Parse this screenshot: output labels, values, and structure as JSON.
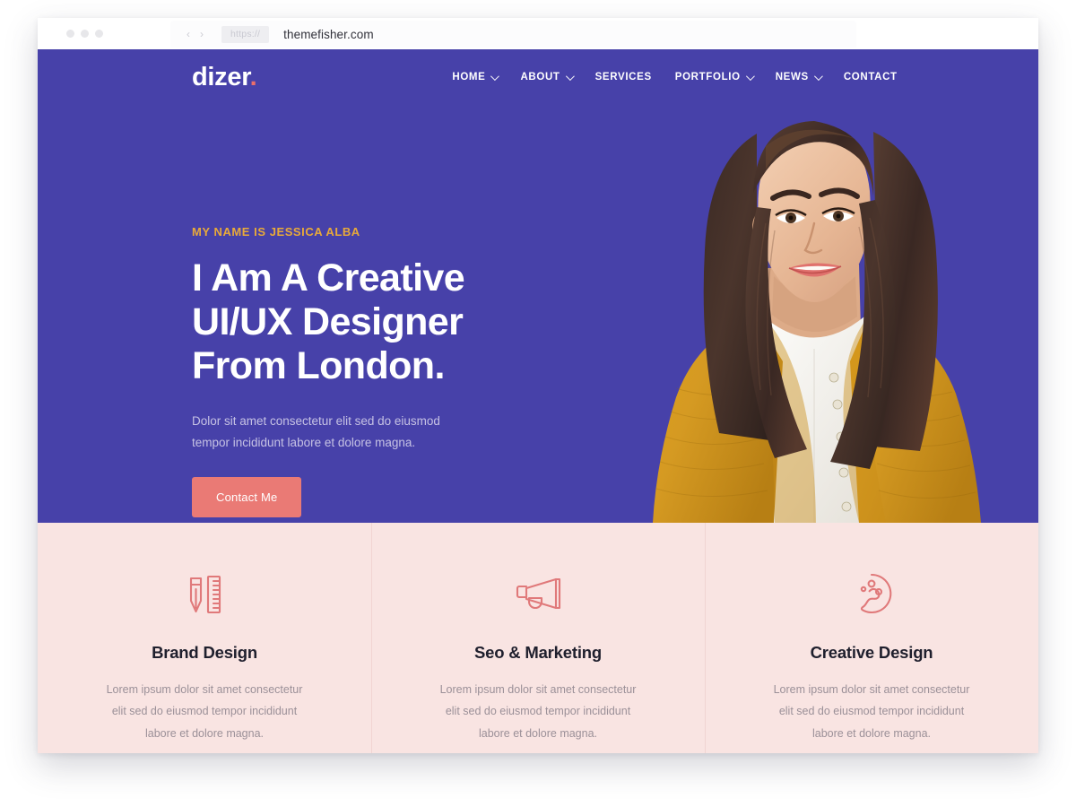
{
  "browser": {
    "traffic_lights": [
      "close",
      "minimize",
      "maximize"
    ],
    "back_arrow": "‹",
    "forward_arrow": "›",
    "scheme_badge": "https://",
    "url": "themefisher.com"
  },
  "colors": {
    "hero_purple": "#4741a9",
    "accent_gold": "#e9aa39",
    "accent_salmon": "#ea7a75",
    "services_pink": "#f9e4e2",
    "heading_dark": "#1f1f2d"
  },
  "header": {
    "logo_text": "dizer",
    "logo_dot": ".",
    "menu": [
      {
        "label": "HOME",
        "has_dropdown": true
      },
      {
        "label": "ABOUT",
        "has_dropdown": true
      },
      {
        "label": "SERVICES",
        "has_dropdown": false
      },
      {
        "label": "PORTFOLIO",
        "has_dropdown": true
      },
      {
        "label": "NEWS",
        "has_dropdown": true
      },
      {
        "label": "CONTACT",
        "has_dropdown": false
      }
    ]
  },
  "hero": {
    "eyebrow": "MY NAME IS JESSICA ALBA",
    "title_line1": "I Am A Creative",
    "title_line2": "UI/UX Designer",
    "title_line3": "From London.",
    "paragraph": "Dolor sit amet consectetur elit sed do eiusmod tempor incididunt labore et dolore magna.",
    "cta_label": "Contact Me",
    "portrait_alt": "smiling woman in mustard cardigan"
  },
  "services": [
    {
      "icon": "pencil-ruler-icon",
      "title": "Brand Design",
      "text": "Lorem ipsum dolor sit amet consectetur elit sed do eiusmod tempor incididunt labore et dolore magna."
    },
    {
      "icon": "megaphone-icon",
      "title": "Seo & Marketing",
      "text": "Lorem ipsum dolor sit amet consectetur elit sed do eiusmod tempor incididunt labore et dolore magna."
    },
    {
      "icon": "paint-palette-icon",
      "title": "Creative Design",
      "text": "Lorem ipsum dolor sit amet consectetur elit sed do eiusmod tempor incididunt labore et dolore magna."
    }
  ]
}
